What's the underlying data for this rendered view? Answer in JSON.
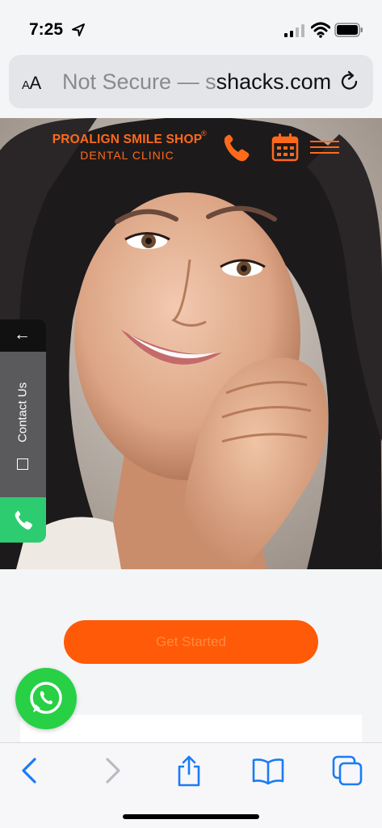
{
  "status_bar": {
    "time": "7:25"
  },
  "browser": {
    "aa_label_small": "A",
    "aa_label_large": "A",
    "url_dim": "Not Secure — ",
    "url_partial": "s",
    "url_domain": "shacks.com"
  },
  "site": {
    "brand_name": "PROALIGN SMILE SHOP",
    "brand_reg": "®",
    "brand_sub": "DENTAL CLINIC"
  },
  "side_tab": {
    "arrow": "←",
    "contact_label": "Contact Us"
  },
  "cta": {
    "label": "Get Started"
  },
  "colors": {
    "accent": "#ff5a08",
    "brand": "#ff6a1a",
    "call_green": "#2ecc71",
    "whatsapp_green": "#27d045",
    "ios_blue": "#1a7cf5"
  }
}
